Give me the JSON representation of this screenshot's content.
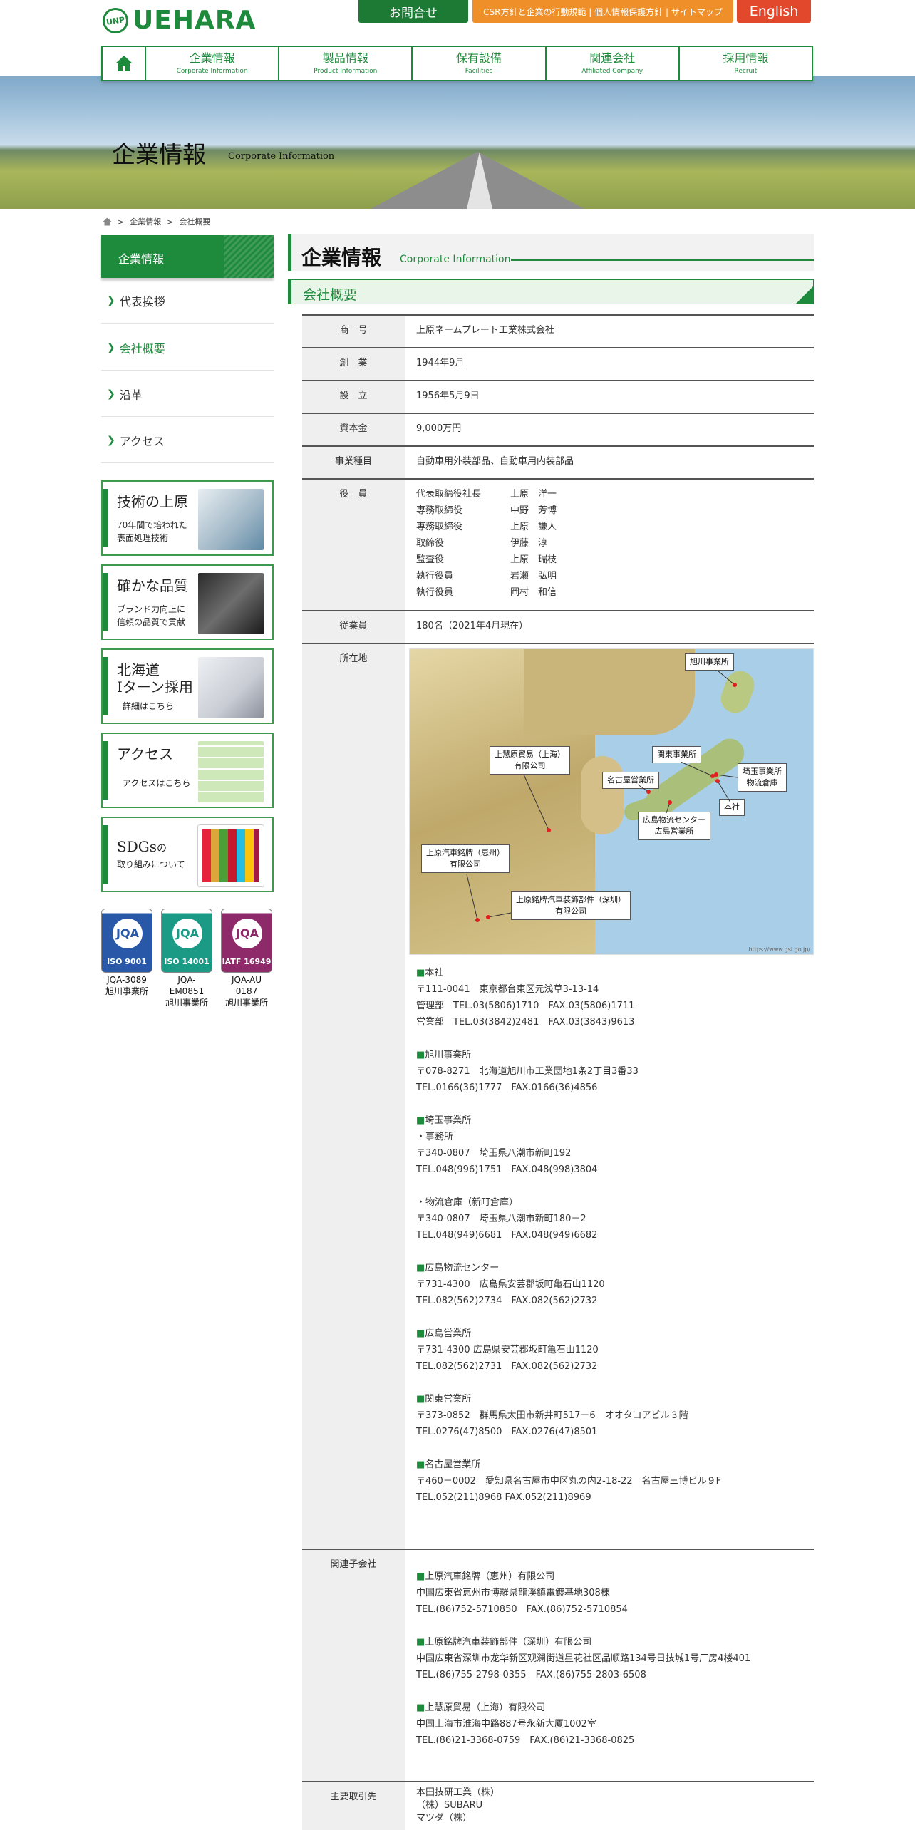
{
  "header": {
    "logo_mark": "UNP",
    "logo_text": "UEHARA",
    "contact": "お問合せ",
    "csr": "CSR方針と企業の行動規範 | 個人情報保護方針 | サイトマップ",
    "english": "English"
  },
  "nav": [
    {
      "jp": "企業情報",
      "en": "Corporate Information"
    },
    {
      "jp": "製品情報",
      "en": "Product Information"
    },
    {
      "jp": "保有設備",
      "en": "Facilities"
    },
    {
      "jp": "関連会社",
      "en": "Affiliated Company"
    },
    {
      "jp": "採用情報",
      "en": "Recruit"
    }
  ],
  "hero": {
    "title": "企業情報",
    "subtitle": "Corporate Information"
  },
  "breadcrumb": {
    "sep": ">",
    "items": [
      "企業情報",
      "会社概要"
    ]
  },
  "sidebar": {
    "header": "企業情報",
    "links": [
      "代表挨拶",
      "会社概要",
      "沿革",
      "アクセス"
    ],
    "chev": "❯",
    "banners": [
      {
        "title": "技術の上原",
        "sub1": "70年間で培われた",
        "sub2": "表面処理技術"
      },
      {
        "title": "確かな品質",
        "sub1": "ブランド力向上に",
        "sub2": "信頼の品質で貢献"
      },
      {
        "title": "北海道",
        "title2": "Iターン採用",
        "sub1": "詳細はこちら"
      },
      {
        "title": "アクセス",
        "sub1": "アクセスはこちら"
      },
      {
        "title": "SDGs",
        "title_suffix": "の",
        "sub1": "取り組みについて"
      }
    ],
    "certs": [
      {
        "std": "ISO 9001",
        "code": "JQA-3089",
        "site": "旭川事業所",
        "color": "#2a58a8"
      },
      {
        "std": "ISO 14001",
        "code": "JQA-EM0851",
        "site": "旭川事業所",
        "color": "#1b9a86"
      },
      {
        "std": "IATF 16949",
        "code": "JQA-AU 0187",
        "site": "旭川事業所",
        "color": "#8e2a6a"
      }
    ],
    "cert_mark": "JQA"
  },
  "page_title": {
    "jp": "企業情報",
    "en": "Corporate Information"
  },
  "section_title": "会社概要",
  "table": {
    "name_label": "商　号",
    "name": "上原ネームプレート工業株式会社",
    "founded_label": "創　業",
    "founded": "1944年9月",
    "established_label": "設　立",
    "established": "1956年5月9日",
    "capital_label": "資本金",
    "capital": "9,000万円",
    "business_label": "事業種目",
    "business": "自動車用外装部品、自動車用内装部品",
    "officers_label": "役　員",
    "officers": [
      {
        "role": "代表取締役社長",
        "name": "上原　洋一"
      },
      {
        "role": "専務取締役",
        "name": "中野　芳博"
      },
      {
        "role": "専務取締役",
        "name": "上原　謙人"
      },
      {
        "role": "取締役",
        "name": "伊藤　淳"
      },
      {
        "role": "監査役",
        "name": "上原　瑞枝"
      },
      {
        "role": "執行役員",
        "name": "岩瀬　弘明"
      },
      {
        "role": "執行役員",
        "name": "岡村　和信"
      }
    ],
    "employees_label": "従業員",
    "employees": "180名（2021年4月現在）",
    "location_label": "所在地",
    "affiliates_label": "関連子会社",
    "clients_label": "主要取引先",
    "clients": [
      "本田技研工業（株）",
      "（株）SUBARU",
      "マツダ（株）"
    ]
  },
  "map": {
    "credit": "https://www.gsi.go.jp/",
    "callouts": [
      "旭川事業所",
      "関東事業所",
      "埼玉事業所",
      "物流倉庫",
      "名古屋営業所",
      "本社",
      "広島物流センター",
      "広島営業所",
      "上慧原貿易（上海）",
      "有限公司",
      "上原汽車銘牌（恵州）",
      "有限公司",
      "上原銘牌汽車装飾部件（深圳）",
      "有限公司"
    ]
  },
  "addresses": [
    {
      "title": "■本社",
      "lines": [
        "〒111-0041　東京都台東区元浅草3-13-14",
        "管理部　TEL.03(5806)1710　FAX.03(5806)1711",
        "営業部　TEL.03(3842)2481　FAX.03(3843)9613"
      ]
    },
    {
      "title": "■旭川事業所",
      "lines": [
        "〒078-8271　北海道旭川市工業団地1条2丁目3番33",
        "TEL.0166(36)1777　FAX.0166(36)4856"
      ]
    },
    {
      "title": "■埼玉事業所",
      "lines": [
        "・事務所",
        "〒340-0807　埼玉県八潮市新町192",
        "TEL.048(996)1751　FAX.048(998)3804",
        "",
        "・物流倉庫（新町倉庫）",
        "〒340-0807　埼玉県八潮市新町180－2",
        "TEL.048(949)6681　FAX.048(949)6682"
      ]
    },
    {
      "title": "■広島物流センター",
      "lines": [
        "〒731-4300　広島県安芸郡坂町亀石山1120",
        "TEL.082(562)2734　FAX.082(562)2732"
      ]
    },
    {
      "title": "■広島営業所",
      "lines": [
        "〒731-4300 広島県安芸郡坂町亀石山1120",
        "TEL.082(562)2731　FAX.082(562)2732"
      ]
    },
    {
      "title": "■関東営業所",
      "lines": [
        "〒373-0852　群馬県太田市新井町517－6　オオタコアビル３階",
        "TEL.0276(47)8500　FAX.0276(47)8501"
      ]
    },
    {
      "title": "■名古屋営業所",
      "lines": [
        "〒460－0002　愛知県名古屋市中区丸の内2-18-22　名古屋三博ビル９F",
        "TEL.052(211)8968 FAX.052(211)8969"
      ]
    }
  ],
  "affiliates": [
    {
      "title": "■上原汽車銘牌（恵州）有限公司",
      "lines": [
        "中国広東省恵州市博羅県龍渓鎮電鍍基地308棟",
        "TEL.(86)752-5710850　FAX.(86)752-5710854"
      ]
    },
    {
      "title": "■上原銘牌汽車装飾部件（深圳）有限公司",
      "lines": [
        "中国広東省深圳市龙华新区观澜街道星花社区品顺路134号日技城1号厂房4楼401",
        "TEL.(86)755-2798-0355　FAX.(86)755-2803-6508"
      ]
    },
    {
      "title": "■上慧原貿易（上海）有限公司",
      "lines": [
        "中国上海市淮海中路887号永新大厦1002室",
        "TEL.(86)21-3368-0759　FAX.(86)21-3368-0825"
      ]
    }
  ]
}
